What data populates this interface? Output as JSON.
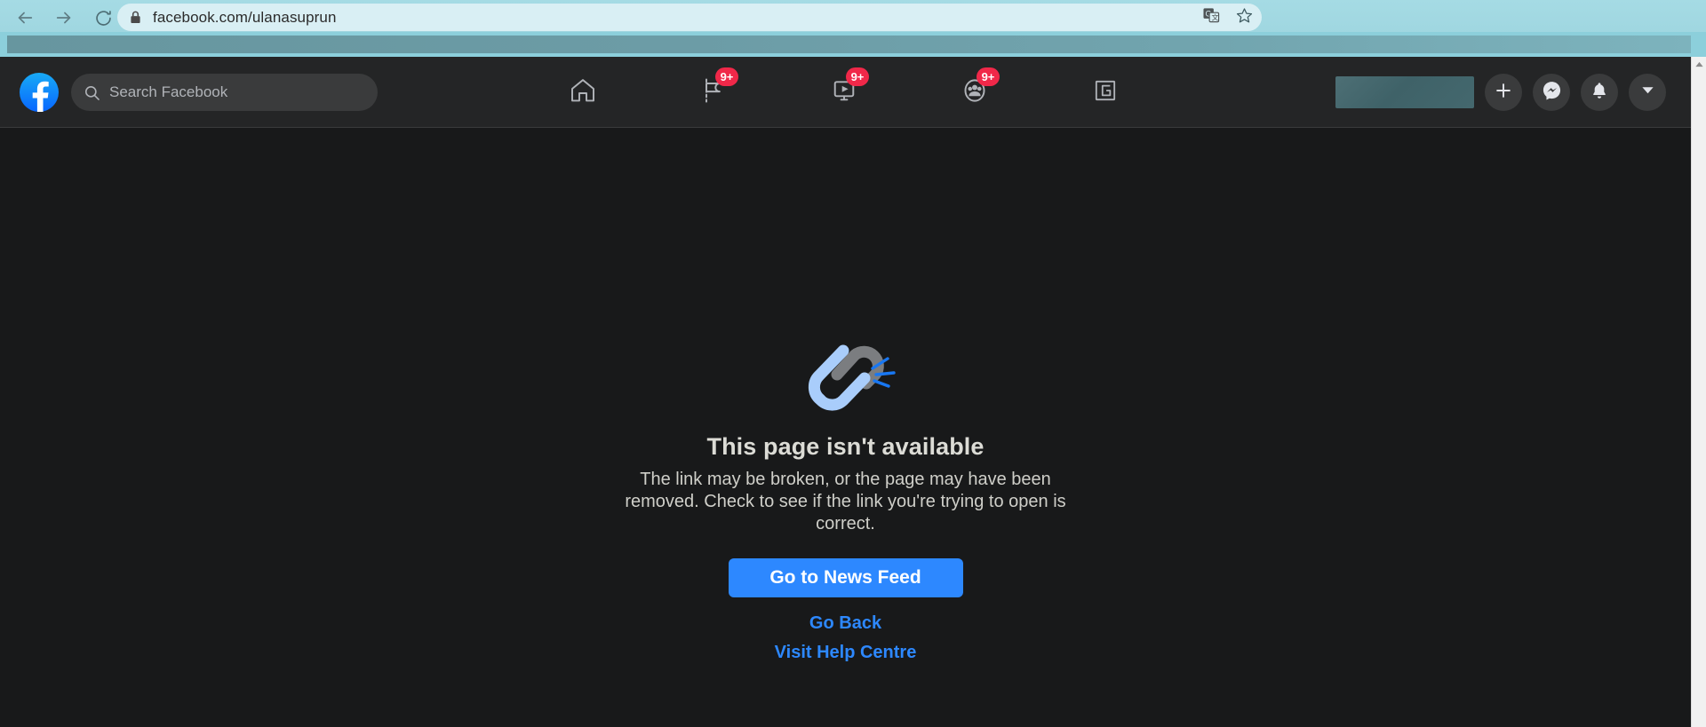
{
  "browser": {
    "back_label": "Back",
    "forward_label": "Forward",
    "reload_label": "Reload",
    "url": "facebook.com/ulanasuprun",
    "lock_icon": "lock-icon",
    "translate_icon": "translate-icon",
    "bookmark_icon": "star-icon",
    "scroll_up_icon": "scroll-up-arrow-icon"
  },
  "navbar": {
    "logo_label": "Facebook",
    "search": {
      "placeholder": "Search Facebook",
      "value": "",
      "icon": "search-icon"
    },
    "tabs": [
      {
        "name": "home",
        "icon": "home-icon",
        "badge": ""
      },
      {
        "name": "pages",
        "icon": "flag-icon",
        "badge": "9+"
      },
      {
        "name": "watch",
        "icon": "video-play-icon",
        "badge": "9+"
      },
      {
        "name": "groups",
        "icon": "groups-icon",
        "badge": "9+"
      },
      {
        "name": "gaming",
        "icon": "gaming-icon",
        "badge": ""
      }
    ],
    "account": {
      "profile_name_redacted": "",
      "create_icon": "plus-icon",
      "messenger_icon": "messenger-icon",
      "notifications_icon": "bell-icon",
      "account_menu_icon": "chevron-down-icon"
    }
  },
  "error_page": {
    "illustration": "broken-link-icon",
    "title": "This page isn't available",
    "description": "The link may be broken, or the page may have been removed. Check to see if the link you're trying to open is correct.",
    "primary_button": "Go to News Feed",
    "link_back": "Go Back",
    "link_help": "Visit Help Centre"
  },
  "colors": {
    "accent_blue": "#2d88ff",
    "badge_red": "#f02849",
    "nav_bg": "#242526",
    "page_bg": "#18191a",
    "chrome_teal": "#9fd6e0",
    "link_gray": "#8a8d91",
    "link_blue_light": "#a9cdfb"
  }
}
